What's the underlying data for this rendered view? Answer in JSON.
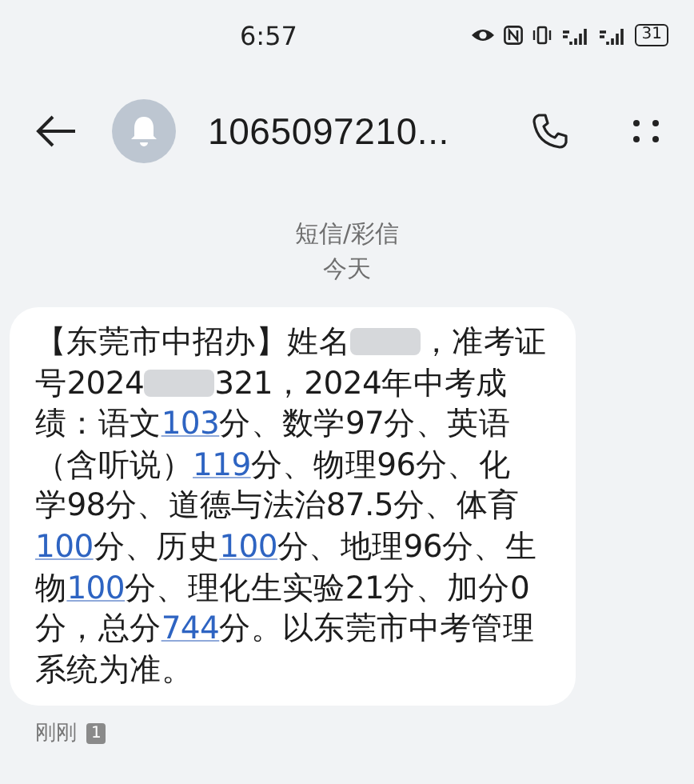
{
  "status_bar": {
    "time": "6:57",
    "battery": "31"
  },
  "header": {
    "title": "1065097210..."
  },
  "conversation_info": {
    "type": "短信/彩信",
    "day": "今天"
  },
  "message": {
    "lines": [
      [
        {
          "kind": "text",
          "text": "【东莞市中招办】姓名"
        },
        {
          "kind": "redacted"
        },
        {
          "kind": "text",
          "text": "，准考证"
        }
      ],
      [
        {
          "kind": "text",
          "text": "号2024"
        },
        {
          "kind": "redacted"
        },
        {
          "kind": "text",
          "text": "321，2024年中考成"
        }
      ],
      [
        {
          "kind": "text",
          "text": "绩：语文"
        },
        {
          "kind": "link",
          "text": "103"
        },
        {
          "kind": "text",
          "text": "分、数学97分、英语"
        }
      ],
      [
        {
          "kind": "text",
          "text": "（含听说）"
        },
        {
          "kind": "link",
          "text": "119"
        },
        {
          "kind": "text",
          "text": "分、物理96分、化"
        }
      ],
      [
        {
          "kind": "text",
          "text": "学98分、道德与法治87.5分、体育"
        }
      ],
      [
        {
          "kind": "link",
          "text": "100"
        },
        {
          "kind": "text",
          "text": "分、历史"
        },
        {
          "kind": "link",
          "text": "100"
        },
        {
          "kind": "text",
          "text": "分、地理96分、生"
        }
      ],
      [
        {
          "kind": "text",
          "text": "物"
        },
        {
          "kind": "link",
          "text": "100"
        },
        {
          "kind": "text",
          "text": "分、理化生实验21分、加分0"
        }
      ],
      [
        {
          "kind": "text",
          "text": "分，总分"
        },
        {
          "kind": "link",
          "text": "744"
        },
        {
          "kind": "text",
          "text": "分。以东莞市中考管理"
        }
      ],
      [
        {
          "kind": "text",
          "text": "系统为准。"
        }
      ]
    ],
    "time": "刚刚",
    "sim": "1"
  }
}
